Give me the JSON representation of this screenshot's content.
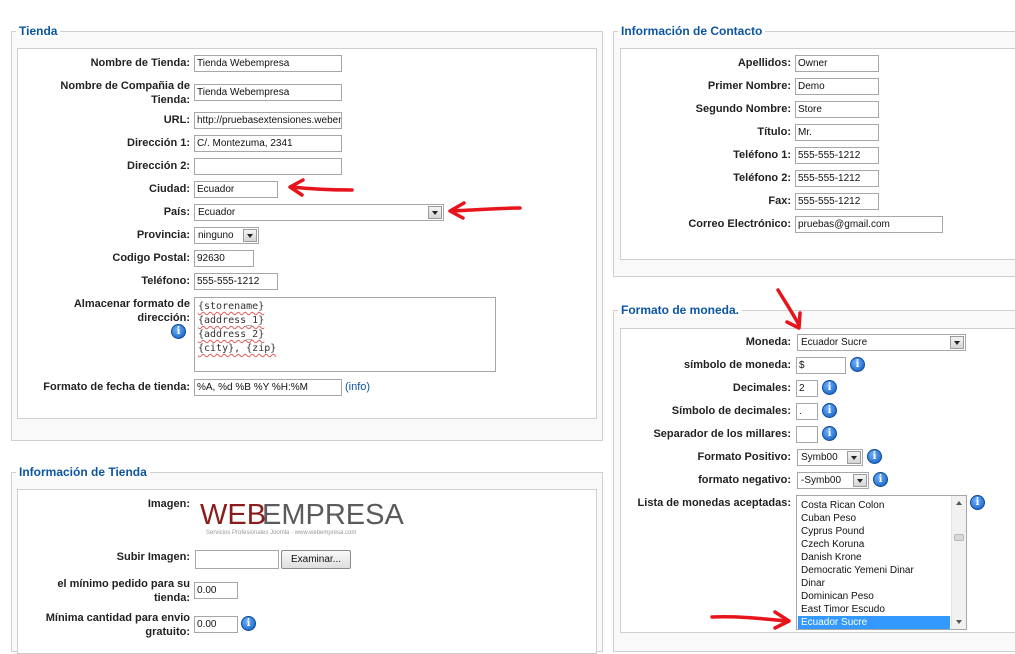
{
  "tienda": {
    "legend": "Tienda",
    "nombre_label": "Nombre de Tienda:",
    "nombre_value": "Tienda Webempresa",
    "compania_label_l1": "Nombre de Compañia de",
    "compania_label_l2": "Tienda:",
    "compania_value": "Tienda Webempresa",
    "url_label": "URL:",
    "url_value": "http://pruebasextensiones.webempresa.eu",
    "dir1_label": "Dirección 1:",
    "dir1_value": "C/. Montezuma, 2341",
    "dir2_label": "Dirección 2:",
    "dir2_value": "",
    "ciudad_label": "Ciudad:",
    "ciudad_value": "Ecuador",
    "pais_label": "País:",
    "pais_value": "Ecuador",
    "provincia_label": "Provincia:",
    "provincia_value": "ninguno",
    "cp_label": "Codigo Postal:",
    "cp_value": "92630",
    "telefono_label": "Teléfono:",
    "telefono_value": "555-555-1212",
    "formato_dir_label_l1": "Almacenar formato de",
    "formato_dir_label_l2": "dirección:",
    "formato_dir_lines": [
      "{storename}",
      "{address_1}",
      "{address_2}",
      "{city}, {zip}"
    ],
    "fecha_label": "Formato de fecha de tienda:",
    "fecha_value": "%A, %d %B %Y %H:%M",
    "fecha_link": "(info)"
  },
  "info_tienda": {
    "legend": "Información de Tienda",
    "imagen_label": "Imagen:",
    "logo_web": "WEB",
    "logo_empresa": "EMPRESA",
    "logo_tagline": "Servicios Profesionales Joomla · www.webempresa.com",
    "subir_label": "Subir Imagen:",
    "examinar_button": "Examinar...",
    "minimo_pedido_label_l1": "el mínimo pedido para su",
    "minimo_pedido_label_l2": "tienda:",
    "minimo_pedido_value": "0.00",
    "envio_label_l1": "Mínima cantidad para envio",
    "envio_label_l2": "gratuito:",
    "envio_value": "0.00"
  },
  "contacto": {
    "legend": "Información de Contacto",
    "apellidos_label": "Apellidos:",
    "apellidos_value": "Owner",
    "primer_label": "Primer Nombre:",
    "primer_value": "Demo",
    "segundo_label": "Segundo Nombre:",
    "segundo_value": "Store",
    "titulo_label": "Título:",
    "titulo_value": "Mr.",
    "tel1_label": "Teléfono 1:",
    "tel1_value": "555-555-1212",
    "tel2_label": "Teléfono 2:",
    "tel2_value": "555-555-1212",
    "fax_label": "Fax:",
    "fax_value": "555-555-1212",
    "correo_label": "Correo Electrónico:",
    "correo_value": "pruebas@gmail.com"
  },
  "moneda": {
    "legend": "Formato de moneda.",
    "moneda_label": "Moneda:",
    "moneda_value": "Ecuador Sucre",
    "simbolo_label": "símbolo de moneda:",
    "simbolo_value": "$",
    "decimales_label": "Decimales:",
    "decimales_value": "2",
    "simbolo_dec_label": "Símbolo de decimales:",
    "simbolo_dec_value": ".",
    "separador_label": "Separador de los millares:",
    "separador_value": "",
    "positivo_label": "Formato Positivo:",
    "positivo_value": "Symb00",
    "negativo_label": "formato negativo:",
    "negativo_value": "-Symb00",
    "lista_label": "Lista de monedas aceptadas:",
    "lista_items": [
      "Costa Rican Colon",
      "Cuban Peso",
      "Cyprus Pound",
      "Czech Koruna",
      "Danish Krone",
      "Democratic Yemeni Dinar",
      "Dinar",
      "Dominican Peso",
      "East Timor Escudo",
      "Ecuador Sucre"
    ],
    "lista_selected": "Ecuador Sucre"
  },
  "colors": {
    "legend_blue": "#0b55a3",
    "annotation_red": "#e8141b",
    "selection_blue": "#3399ff"
  }
}
